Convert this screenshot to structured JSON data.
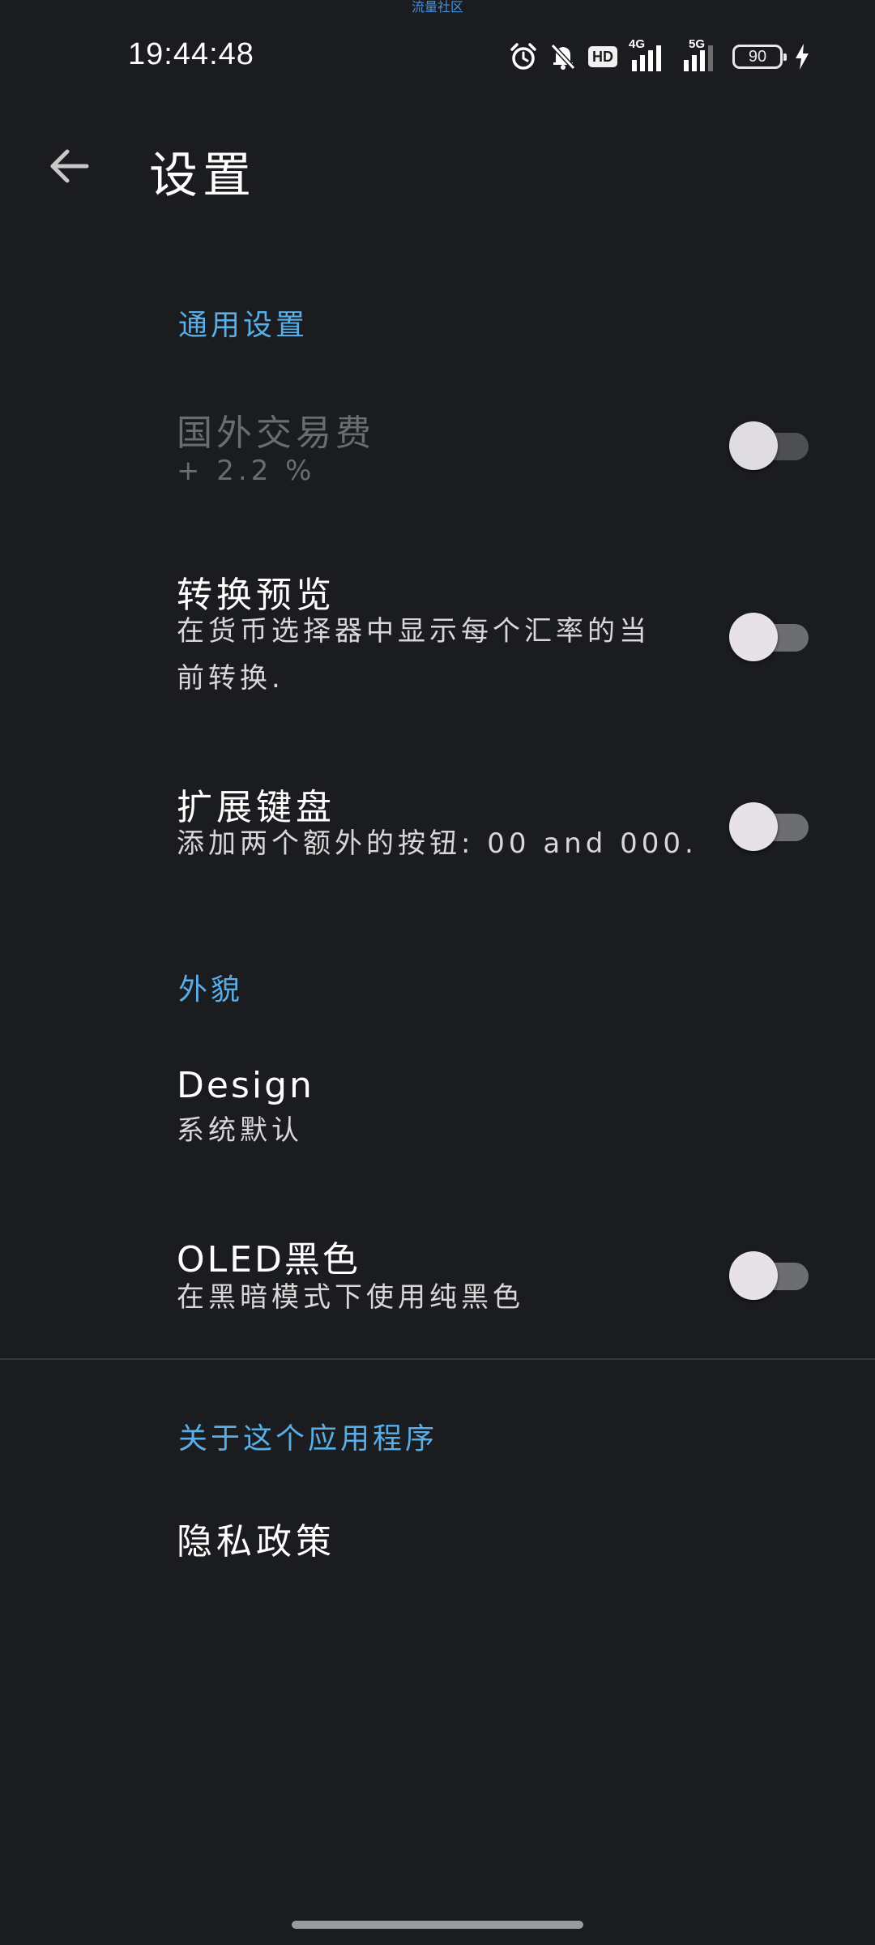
{
  "status_bar": {
    "carrier_text": "流量社区",
    "time": "19:44:48",
    "hd_label": "HD",
    "net1": "4G",
    "net2": "5G",
    "battery_level": "90"
  },
  "app_bar": {
    "title": "设置"
  },
  "sections": {
    "general": {
      "header": "通用设置",
      "foreign_fee": {
        "title": "国外交易费",
        "subtitle": "+ 2.2 %",
        "enabled": false,
        "checked": false
      },
      "conversion_preview": {
        "title": "转换预览",
        "subtitle": "在货币选择器中显示每个汇率的当前转换.",
        "checked": false
      },
      "extended_keyboard": {
        "title": "扩展键盘",
        "subtitle": "添加两个额外的按钮: 00 and 000.",
        "checked": false
      }
    },
    "appearance": {
      "header": "外貌",
      "design": {
        "title": "Design",
        "subtitle": "系统默认"
      },
      "oled": {
        "title": "OLED黑色",
        "subtitle": "在黑暗模式下使用纯黑色",
        "checked": false
      }
    },
    "about": {
      "header": "关于这个应用程序",
      "privacy": {
        "title": "隐私政策"
      }
    }
  },
  "colors": {
    "background": "#1a1c1f",
    "accent": "#5aaee8",
    "text_primary": "#ffffff",
    "text_disabled": "#6a6c70"
  }
}
